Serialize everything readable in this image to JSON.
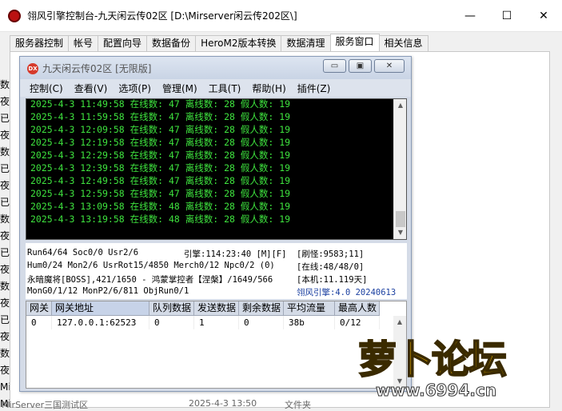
{
  "outer": {
    "title": "翎风引擎控制台-九天闲云传02区 [D:\\Mirserver闲云传202区\\]",
    "minimize_glyph": "—",
    "maximize_glyph": "☐",
    "close_glyph": "✕",
    "tabs": [
      {
        "label": "服务器控制",
        "active": false
      },
      {
        "label": "帐号",
        "active": false
      },
      {
        "label": "配置向导",
        "active": false
      },
      {
        "label": "数据备份",
        "active": false
      },
      {
        "label": "HeroM2版本转换",
        "active": false
      },
      {
        "label": "数据清理",
        "active": false
      },
      {
        "label": "服务窗口",
        "active": true
      },
      {
        "label": "相关信息",
        "active": false
      }
    ],
    "left_strip": [
      "数",
      "夜",
      "已",
      "夜",
      "数",
      "已",
      "夜",
      "已",
      "数",
      "夜",
      "已",
      "夜",
      "数",
      "夜",
      "已",
      "夜",
      "数",
      "夜",
      "Mi",
      "Mi"
    ],
    "bottom_status": {
      "left": "MirServer三国测试区",
      "mid": "2025-4-3 13:50",
      "right": "文件夹"
    }
  },
  "inner": {
    "title": "九天闲云传02区 [无限版]",
    "icon_label": "DX",
    "buttons": {
      "min": "▭",
      "max": "▣",
      "close": "✕"
    },
    "menu": [
      "控制(C)",
      "查看(V)",
      "选项(P)",
      "管理(M)",
      "工具(T)",
      "帮助(H)",
      "插件(Z)"
    ],
    "log_lines": [
      "2025-4-3 11:49:58 在线数: 47 离线数: 28 假人数: 19",
      "2025-4-3 11:59:58 在线数: 47 离线数: 28 假人数: 19",
      "2025-4-3 12:09:58 在线数: 47 离线数: 28 假人数: 19",
      "2025-4-3 12:19:58 在线数: 47 离线数: 28 假人数: 19",
      "2025-4-3 12:29:58 在线数: 47 离线数: 28 假人数: 19",
      "2025-4-3 12:39:58 在线数: 47 离线数: 28 假人数: 19",
      "2025-4-3 12:49:58 在线数: 47 离线数: 28 假人数: 19",
      "2025-4-3 12:59:58 在线数: 47 离线数: 28 假人数: 19",
      "2025-4-3 13:09:58 在线数: 48 离线数: 28 假人数: 19",
      "2025-4-3 13:19:58 在线数: 48 离线数: 28 假人数: 19"
    ],
    "status": {
      "row1_left": "Run64/64 Soc0/0 Usr2/6",
      "row1_mid": "引擎:114:23:40 [M][F]",
      "row1_right": "[刷怪:9583;11]",
      "row2_left": "Hum0/24 Mon2/6 UsrRot15/4850 Merch0/12 Npc0/2 (0)",
      "row2_right": "[在线:48/48/0]",
      "row3_left": "永暗魔将[BOSS],421/1650 - 鸿蒙掌控者【涅槃】/1649/566",
      "row3_right": "[本机:11.119天]",
      "row4_left": "MonG0/1/12 MonP2/6/811 ObjRun0/1",
      "row4_right": "翎风引擎:4.0 20240613"
    },
    "table": {
      "headers": [
        "网关",
        "网关地址",
        "队列数据",
        "发送数据",
        "剩余数据",
        "平均流量",
        "最高人数"
      ],
      "rows": [
        [
          "0",
          "127.0.0.1:62523",
          "0",
          "1",
          "0",
          "38b",
          "0/12"
        ]
      ]
    }
  },
  "watermark": {
    "text": "萝卜论坛",
    "url": "www.6994.cn"
  }
}
